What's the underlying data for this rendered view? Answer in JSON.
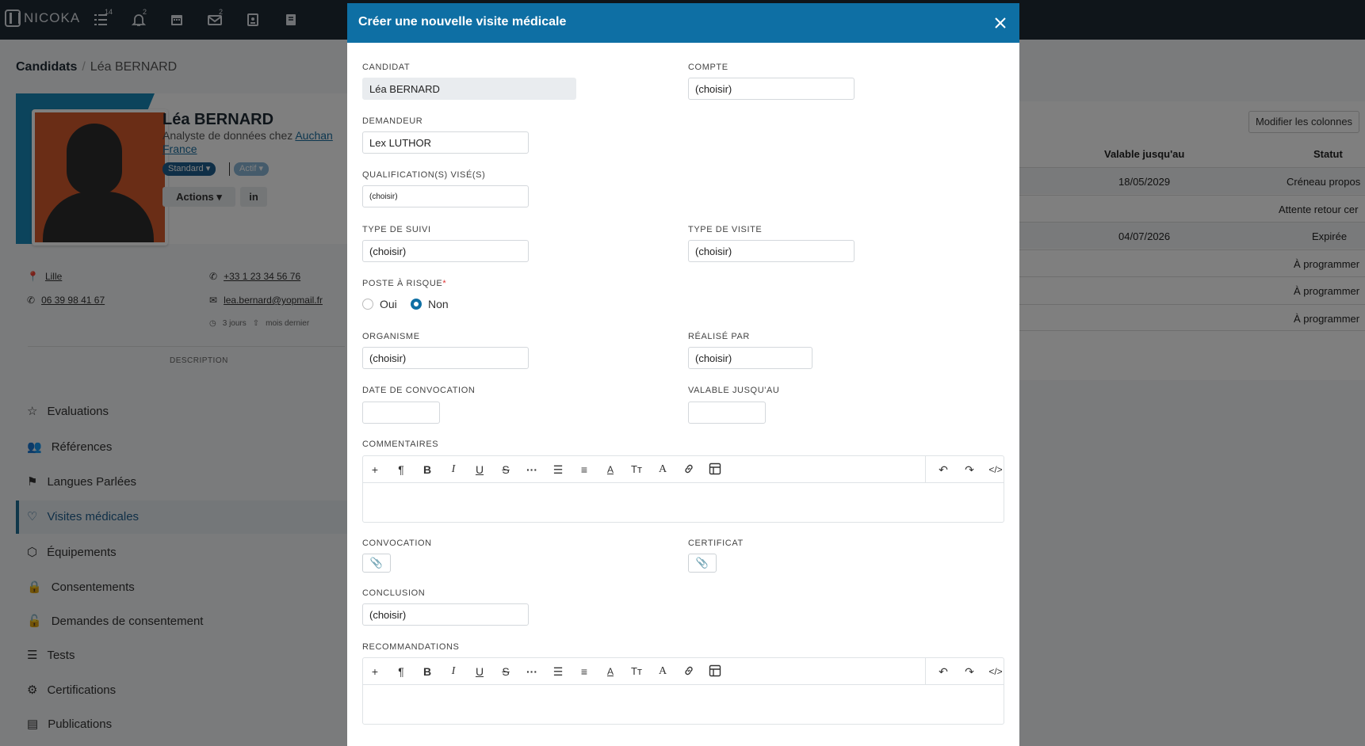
{
  "app": {
    "logo": "NICOKA",
    "nav_badges": {
      "tasks": "14",
      "notifications": "2",
      "messages": "2"
    }
  },
  "breadcrumb": {
    "root": "Candidats",
    "current": "Léa BERNARD"
  },
  "profile": {
    "name": "Léa BERNARD",
    "title_prefix": "Analyste de données chez ",
    "company": "Auchan France",
    "tag_standard": "Standard ▾",
    "tag_actif": "Actif ▾",
    "actions_label": "Actions",
    "linkedin_label": "in",
    "city": "Lille",
    "phone1": "+33 1 23 34 56 76",
    "phone2": "06 39 98 41 67",
    "email": "lea.bernard@yopmail.fr",
    "meta1": "3 jours",
    "meta2": "mois dernier",
    "description_label": "DESCRIPTION"
  },
  "sidebar": {
    "items": [
      {
        "label": "Evaluations"
      },
      {
        "label": "Références"
      },
      {
        "label": "Langues Parlées"
      },
      {
        "label": "Visites médicales"
      },
      {
        "label": "Équipements"
      },
      {
        "label": "Consentements"
      },
      {
        "label": "Demandes de consentement"
      },
      {
        "label": "Tests"
      },
      {
        "label": "Certifications"
      },
      {
        "label": "Publications"
      }
    ]
  },
  "table": {
    "modify_columns": "Modifier les colonnes",
    "headers": [
      "Valable jusqu'au",
      "Statut"
    ],
    "rows": [
      {
        "valid": "18/05/2029",
        "status": "Créneau propos"
      },
      {
        "valid": "",
        "status": "Attente retour cer"
      },
      {
        "valid": "04/07/2026",
        "status": "Expirée"
      },
      {
        "valid": "",
        "status": "À programmer"
      },
      {
        "valid": "",
        "status": "À programmer"
      },
      {
        "valid": "",
        "status": "À programmer"
      }
    ]
  },
  "modal": {
    "title": "Créer une nouvelle visite médicale",
    "labels": {
      "candidat": "CANDIDAT",
      "compte": "COMPTE",
      "demandeur": "DEMANDEUR",
      "qualification": "QUALIFICATION(S) VISÉ(S)",
      "type_suivi": "TYPE DE SUIVI",
      "type_visite": "TYPE DE VISITE",
      "poste_risque": "POSTE À RISQUE",
      "required_mark": "*",
      "organisme": "ORGANISME",
      "realise_par": "RÉALISÉ PAR",
      "date_convocation": "DATE DE CONVOCATION",
      "valable": "VALABLE JUSQU'AU",
      "commentaires": "COMMENTAIRES",
      "convocation": "CONVOCATION",
      "certificat": "CERTIFICAT",
      "conclusion": "CONCLUSION",
      "recommandations": "RECOMMANDATIONS"
    },
    "values": {
      "candidat": "Léa BERNARD",
      "compte": "(choisir)",
      "demandeur": "Lex LUTHOR",
      "qualification": "(choisir)",
      "type_suivi": "(choisir)",
      "type_visite": "(choisir)",
      "organisme": "(choisir)",
      "realise_par": "(choisir)",
      "date_convocation": "",
      "valable": "",
      "conclusion": "(choisir)"
    },
    "radio": {
      "oui": "Oui",
      "non": "Non",
      "selected": "non"
    },
    "editor_tools": [
      "add-icon",
      "paragraph-icon",
      "bold-icon",
      "italic-icon",
      "underline-icon",
      "strikethrough-icon",
      "more-icon",
      "list-icon",
      "align-icon",
      "font-color-icon",
      "font-size-icon",
      "font-family-icon",
      "link-icon",
      "table-icon",
      "undo-icon",
      "redo-icon",
      "code-view-icon"
    ]
  },
  "colors": {
    "header": "#0e6fa4",
    "topnav": "#1f2a35",
    "accent": "#1989b8"
  }
}
